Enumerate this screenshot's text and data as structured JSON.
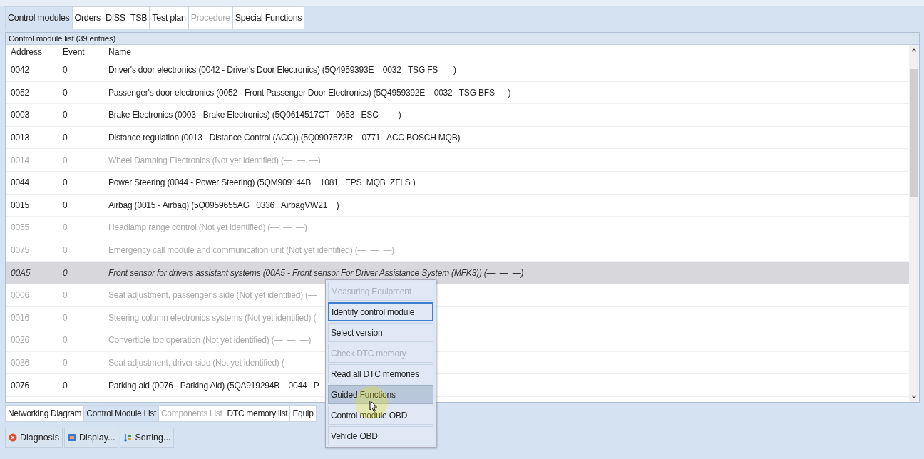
{
  "tabs": [
    {
      "label": "Control modules",
      "selected": true,
      "disabled": false
    },
    {
      "label": "Orders",
      "selected": false,
      "disabled": false
    },
    {
      "label": "DISS",
      "selected": false,
      "disabled": false
    },
    {
      "label": "TSB",
      "selected": false,
      "disabled": false
    },
    {
      "label": "Test plan",
      "selected": false,
      "disabled": false
    },
    {
      "label": "Procedure",
      "selected": false,
      "disabled": true
    },
    {
      "label": "Special Functions",
      "selected": false,
      "disabled": false
    }
  ],
  "list": {
    "title": "Control module list (39 entries)",
    "columns": [
      "Address",
      "Event",
      "Name"
    ],
    "rows": [
      {
        "address": "0042",
        "event": "0",
        "name": "Driver's door electronics (0042 - Driver's Door Electronics) (5Q4959393E    0032   TSG FS       )",
        "identified": true,
        "selected": false
      },
      {
        "address": "0052",
        "event": "0",
        "name": "Passenger's door electronics (0052 - Front Passenger Door Electronics) (5Q4959392E    0032   TSG BFS      )",
        "identified": true,
        "selected": false
      },
      {
        "address": "0003",
        "event": "0",
        "name": "Brake Electronics (0003 - Brake Electronics) (5Q0614517CT   0653   ESC         )",
        "identified": true,
        "selected": false
      },
      {
        "address": "0013",
        "event": "0",
        "name": "Distance regulation (0013 - Distance Control (ACC)) (5Q0907572R    0771   ACC BOSCH MQB)",
        "identified": true,
        "selected": false
      },
      {
        "address": "0014",
        "event": "0",
        "name": "Wheel Damping Electronics (Not yet identified) (—  —  —)",
        "identified": false,
        "selected": false
      },
      {
        "address": "0044",
        "event": "0",
        "name": "Power Steering (0044 - Power Steering) (5QM909144B    1081   EPS_MQB_ZFLS )",
        "identified": true,
        "selected": false
      },
      {
        "address": "0015",
        "event": "0",
        "name": "Airbag (0015 - Airbag) (5Q0959655AG   0336   AirbagVW21    )",
        "identified": true,
        "selected": false
      },
      {
        "address": "0055",
        "event": "0",
        "name": "Headlamp range control (Not yet identified) (—  —  —)",
        "identified": false,
        "selected": false
      },
      {
        "address": "0075",
        "event": "0",
        "name": "Emergency call module and communication unit (Not yet identified) (—  —  —)",
        "identified": false,
        "selected": false
      },
      {
        "address": "00A5",
        "event": "0",
        "name": "Front sensor for drivers assistant systems (00A5 - Front sensor For Driver Assistance System (MFK3)) (—  —  —)",
        "identified": false,
        "selected": true
      },
      {
        "address": "0006",
        "event": "0",
        "name": "Seat adjustment, passenger's side (Not yet identified) (—",
        "identified": false,
        "selected": false
      },
      {
        "address": "0016",
        "event": "0",
        "name": "Steering column electronics systems (Not yet identified) (",
        "identified": false,
        "selected": false
      },
      {
        "address": "0026",
        "event": "0",
        "name": "Convertible top operation (Not yet identified) (—  —  —)",
        "identified": false,
        "selected": false
      },
      {
        "address": "0036",
        "event": "0",
        "name": "Seat adjustment, driver side (Not yet identified) (—  —",
        "identified": false,
        "selected": false
      },
      {
        "address": "0076",
        "event": "0",
        "name": "Parking aid (0076 - Parking Aid) (5QA919294B    0044   P",
        "identified": true,
        "selected": false
      }
    ]
  },
  "menu": [
    {
      "label": "Measuring Equipment",
      "disabled": true,
      "focused": false,
      "hovered": false
    },
    {
      "label": "Identify control module",
      "disabled": false,
      "focused": true,
      "hovered": false
    },
    {
      "label": "Select version",
      "disabled": false,
      "focused": false,
      "hovered": false
    },
    {
      "label": "Check DTC memory",
      "disabled": true,
      "focused": false,
      "hovered": false
    },
    {
      "label": "Read all DTC memories",
      "disabled": false,
      "focused": false,
      "hovered": false
    },
    {
      "label": "Guided Functions",
      "disabled": false,
      "focused": false,
      "hovered": true
    },
    {
      "label": "Control module OBD",
      "disabled": false,
      "focused": false,
      "hovered": false
    },
    {
      "label": "Vehicle OBD",
      "disabled": false,
      "focused": false,
      "hovered": false
    }
  ],
  "bottom_tabs": [
    {
      "label": "Networking Diagram",
      "selected": false,
      "disabled": false
    },
    {
      "label": "Control Module List",
      "selected": true,
      "disabled": false
    },
    {
      "label": "Components List",
      "selected": false,
      "disabled": true
    },
    {
      "label": "DTC memory list",
      "selected": false,
      "disabled": false
    },
    {
      "label": "Equip",
      "selected": false,
      "disabled": false
    }
  ],
  "toolbar": [
    {
      "label": "Diagnosis",
      "kind": "diagnosis"
    },
    {
      "label": "Display...",
      "kind": "display"
    },
    {
      "label": "Sorting...",
      "kind": "sorting"
    }
  ]
}
